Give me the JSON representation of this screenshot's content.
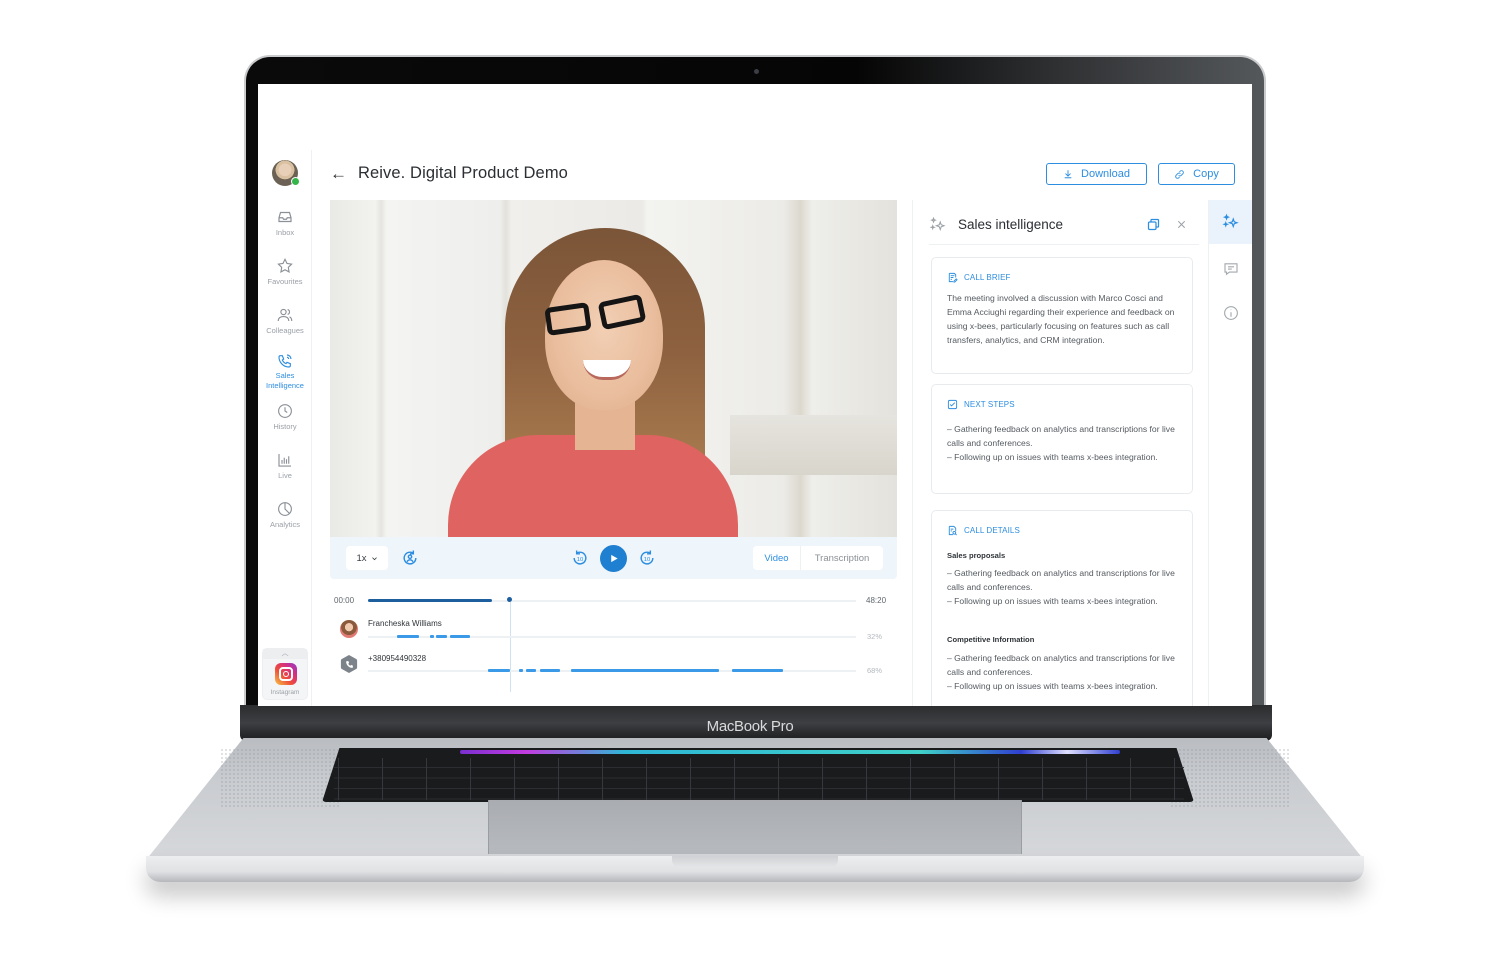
{
  "device": {
    "brand_label": "MacBook Pro"
  },
  "app": {
    "user_status": "online",
    "header": {
      "title": "Reive. Digital Product Demo",
      "download_label": "Download",
      "copy_label": "Copy"
    },
    "sidebar": {
      "items": [
        {
          "label": "Inbox",
          "icon": "inbox-icon",
          "active": false
        },
        {
          "label": "Favourites",
          "icon": "star-icon",
          "active": false
        },
        {
          "label": "Colleagues",
          "icon": "users-icon",
          "active": false
        },
        {
          "label": "Sales Intelligence",
          "icon": "phone-waves-icon",
          "active": true
        },
        {
          "label": "History",
          "icon": "clock-icon",
          "active": false
        },
        {
          "label": "Live",
          "icon": "bar-chart-icon",
          "active": false
        },
        {
          "label": "Analytics",
          "icon": "pie-chart-icon",
          "active": false
        }
      ],
      "integration": {
        "label": "Instagram",
        "icon": "instagram-icon"
      }
    },
    "player": {
      "speed": "1x",
      "rewind_label": "10",
      "forward_label": "10",
      "view_tabs": [
        {
          "label": "Video",
          "active": true
        },
        {
          "label": "Transcription",
          "active": false
        }
      ],
      "time_start": "00:00",
      "time_end": "48:20",
      "progress_fraction": 0.29,
      "speakers": [
        {
          "name": "Francheska Williams",
          "share": "32%",
          "segments": [
            [
              0.06,
              0.105
            ],
            [
              0.127,
              0.135
            ],
            [
              0.14,
              0.162
            ],
            [
              0.168,
              0.21
            ]
          ]
        },
        {
          "name": "+380954490328",
          "share": "68%",
          "segments": [
            [
              0.245,
              0.29
            ],
            [
              0.31,
              0.318
            ],
            [
              0.324,
              0.345
            ],
            [
              0.352,
              0.393
            ],
            [
              0.415,
              0.72
            ],
            [
              0.745,
              0.85
            ]
          ]
        }
      ]
    },
    "panel": {
      "title": "Sales intelligence",
      "cards": {
        "call_brief": {
          "title": "CALL BRIEF",
          "text": "The meeting involved a discussion with Marco Cosci and Emma Acciughi regarding their experience and feedback on using x-bees, particularly focusing on features such as call transfers, analytics, and CRM integration."
        },
        "next_steps": {
          "title": "NEXT STEPS",
          "lines": [
            "– Gathering feedback on analytics and transcriptions for live calls and conferences.",
            "– Following up on issues with teams x-bees integration."
          ]
        },
        "call_details": {
          "title": "CALL DETAILS",
          "sections": [
            {
              "heading": "Sales proposals",
              "lines": [
                "– Gathering feedback on analytics and transcriptions for live calls and conferences.",
                "– Following up on issues with teams x-bees integration."
              ]
            },
            {
              "heading": "Competitive Information",
              "lines": [
                "– Gathering feedback on analytics and transcriptions for live calls and conferences.",
                "– Following up on issues with teams x-bees integration."
              ]
            }
          ]
        }
      }
    },
    "colors": {
      "accent": "#2d8ee0",
      "play_button": "#1f7fd0",
      "progress": "#1d5f9e",
      "segment": "#3a9ae8",
      "status_online": "#35b44a"
    }
  }
}
